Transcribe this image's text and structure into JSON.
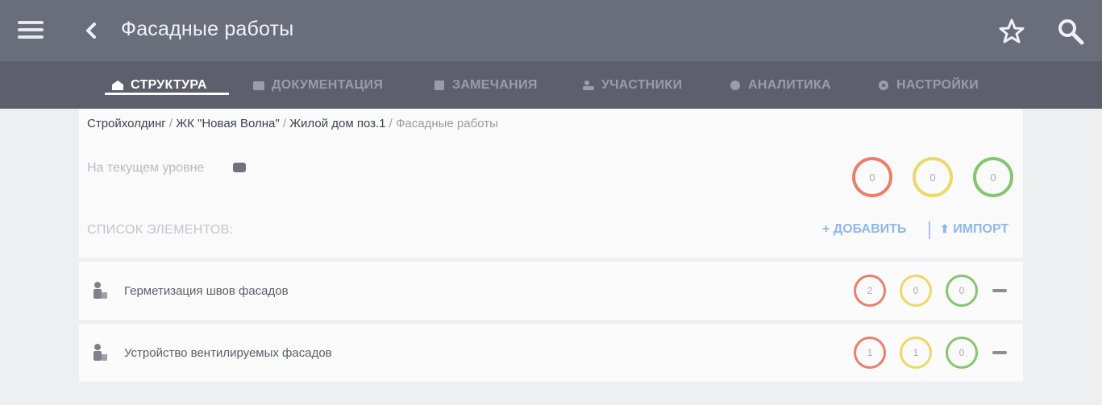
{
  "header": {
    "title": "Фасадные работы"
  },
  "tabs": [
    {
      "label": "СТРУКТУРА",
      "icon": "building-icon"
    },
    {
      "label": "ДОКУМЕНТАЦИЯ",
      "icon": "folder-icon"
    },
    {
      "label": "ЗАМЕЧАНИЯ",
      "icon": "notes-icon"
    },
    {
      "label": "УЧАСТНИКИ",
      "icon": "people-icon"
    },
    {
      "label": "АНАЛИТИКА",
      "icon": "globe-icon"
    },
    {
      "label": "НАСТРОЙКИ",
      "icon": "gear-icon"
    }
  ],
  "breadcrumb": {
    "items": [
      "Стройхолдинг",
      "ЖК \"Новая Волна\"",
      "Жилой дом поз.1"
    ],
    "separator": " / ",
    "current": "Фасадные работы"
  },
  "level": {
    "label": "На текущем уровне",
    "counts": {
      "red": "0",
      "yellow": "0",
      "green": "0"
    }
  },
  "list": {
    "label": "СПИСОК ЭЛЕМЕНТОВ:",
    "add_label": "+ ДОБАВИТЬ",
    "import_label": "ИМПОРТ",
    "items": [
      {
        "title": "Герметизация швов фасадов",
        "counts": {
          "red": "2",
          "yellow": "0",
          "green": "0"
        }
      },
      {
        "title": "Устройство вентилируемых фасадов",
        "counts": {
          "red": "1",
          "yellow": "1",
          "green": "0"
        }
      }
    ]
  },
  "colors": {
    "topbar": "#6a6d7a",
    "tabbar": "#5d606c",
    "red": "#e8806a",
    "yellow": "#ecd86a",
    "green": "#86c56f",
    "link": "#8fb8e6"
  }
}
